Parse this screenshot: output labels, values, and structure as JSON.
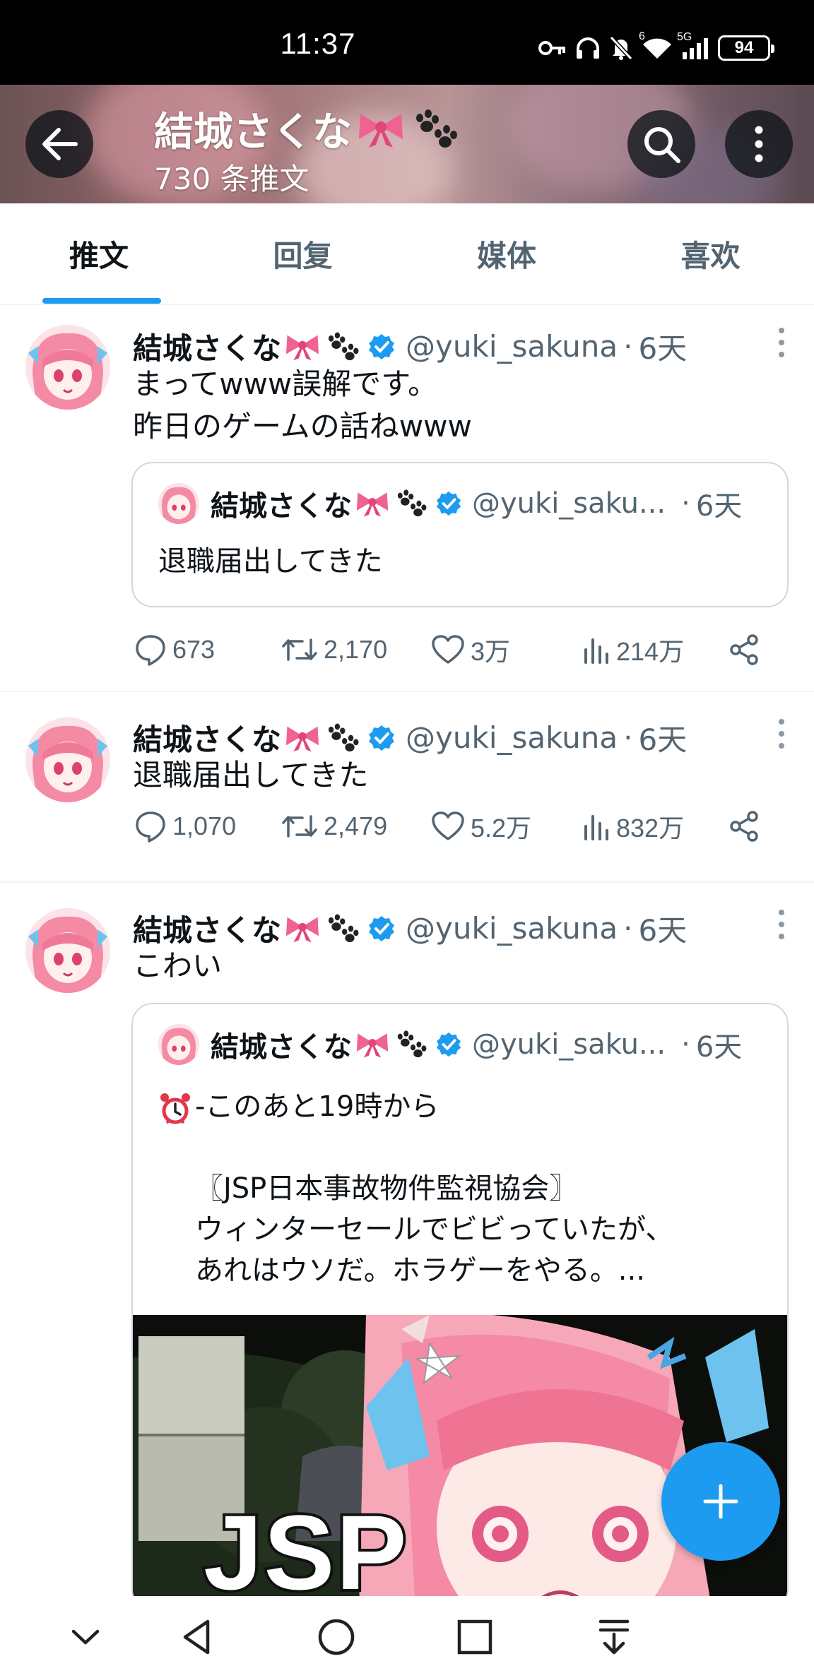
{
  "status_bar": {
    "time": "11:37",
    "battery": "94",
    "network_badge_wifi": "6",
    "network_badge_cell": "5G"
  },
  "header": {
    "title": "結城さくな",
    "tweet_count": "730 条推文"
  },
  "tabs": [
    {
      "label": "推文",
      "active": true
    },
    {
      "label": "回复",
      "active": false
    },
    {
      "label": "媒体",
      "active": false
    },
    {
      "label": "喜欢",
      "active": false
    }
  ],
  "tweets": [
    {
      "name": "結城さくな",
      "handle": "@yuki_sakuna",
      "dot": "·",
      "time": "6天",
      "text": "まってwww誤解です。\n昨日のゲームの話ねwww",
      "quote": {
        "name": "結城さくな",
        "handle": "@yuki_saku...",
        "dot": "·",
        "time": "6天",
        "text": "退職届出してきた"
      },
      "replies": "673",
      "retweets": "2,170",
      "likes": "3万",
      "views": "214万"
    },
    {
      "name": "結城さくな",
      "handle": "@yuki_sakuna",
      "dot": "·",
      "time": "6天",
      "text": "退職届出してきた",
      "replies": "1,070",
      "retweets": "2,479",
      "likes": "5.2万",
      "views": "832万"
    },
    {
      "name": "結城さくな",
      "handle": "@yuki_sakuna",
      "dot": "·",
      "time": "6天",
      "text": "こわい",
      "quote": {
        "name": "結城さくな",
        "handle": "@yuki_saku...",
        "dot": "·",
        "time": "6天",
        "text": "-このあと19時から\n\n〖JSP日本事故物件監視協会〗\nウィンターセールでビビっていたが、\nあれはウソだ。ホラゲーをやる。...",
        "image_text": "JSP"
      }
    }
  ],
  "colors": {
    "accent": "#1d9bf0",
    "verified": "#1d9bf0",
    "secondary_text": "#536471",
    "bow": "#f06291"
  },
  "icons": {
    "back": "arrow-left-icon",
    "search": "search-icon",
    "more": "more-vertical-icon",
    "reply": "reply-icon",
    "retweet": "retweet-icon",
    "like": "heart-icon",
    "views": "views-icon",
    "share": "share-icon",
    "compose": "plus-icon"
  }
}
